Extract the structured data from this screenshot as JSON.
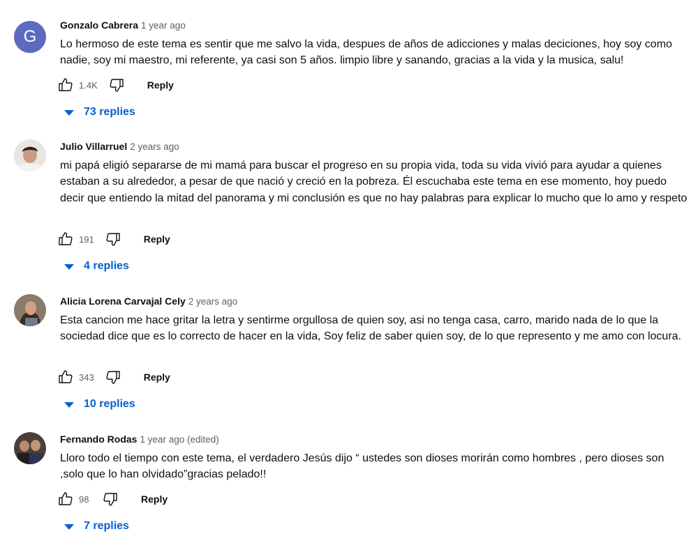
{
  "comments": [
    {
      "avatar_letter": "G",
      "author": "Gonzalo Cabrera",
      "time": "1 year ago",
      "text": "Lo hermoso de este tema es sentir que me salvo la vida, despues de años de adicciones y malas deciciones, hoy soy como nadie, soy mi maestro, mi referente, ya casi son 5 años. limpio libre y sanando, gracias a la vida y la musica, salu!",
      "likes": "1.4K",
      "reply_label": "Reply",
      "replies_label": "73 replies"
    },
    {
      "author": "Julio Villarruel",
      "time": "2 years ago",
      "text": "mi papá eligió separarse de mi mamá para buscar el progreso en su propia vida, toda su vida vivió para ayudar a quienes estaban a su alrededor, a pesar de que nació y creció en la pobreza. Él escuchaba este tema en ese momento, hoy puedo decir que entiendo la mitad del panorama y mi conclusión es que no hay palabras para explicar lo mucho que lo amo y respeto",
      "likes": "191",
      "reply_label": "Reply",
      "replies_label": "4 replies"
    },
    {
      "author": "Alicia Lorena Carvajal Cely",
      "time": "2 years ago",
      "text": "Esta cancion me hace gritar la letra y sentirme orgullosa de quien soy, asi no tenga casa, carro, marido nada de lo que la sociedad dice que es lo correcto de hacer en la vida, Soy feliz de saber quien soy, de lo que represento y me amo con locura.",
      "likes": "343",
      "reply_label": "Reply",
      "replies_label": "10 replies"
    },
    {
      "author": "Fernando Rodas",
      "time": "1 year ago (edited)",
      "text": "Lloro todo el tiempo con este tema, el verdadero Jesús dijo “ ustedes son dioses morirán como hombres , pero dioses son ,solo que lo han olvidado”gracias pelado!!",
      "likes": "98",
      "reply_label": "Reply",
      "replies_label": "7 replies"
    }
  ],
  "icons": {
    "like": "thumb-up-icon",
    "dislike": "thumb-down-icon",
    "expand": "caret-down-icon"
  },
  "colors": {
    "link": "#065fd4",
    "secondary_text": "#606060",
    "avatar_letter_bg": "#5c6bc0"
  }
}
